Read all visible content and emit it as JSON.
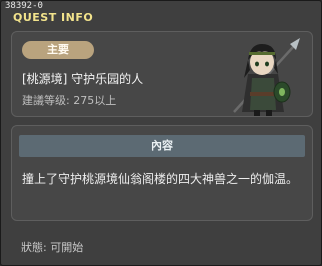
{
  "window": {
    "id": "38392-0",
    "title": "QUEST INFO"
  },
  "quest": {
    "badge": "主要",
    "name": "[桃源境] 守护乐园的人",
    "level": "建議等级: 275以上",
    "character_icon": "warrior-character-icon"
  },
  "content": {
    "header": "內容",
    "text": "撞上了守护桃源境仙翁阁楼的四大神兽之一的伽温。"
  },
  "status": {
    "text": "狀態: 可開始"
  },
  "colors": {
    "title": "#f2e38c",
    "badge": "#b9a37e",
    "header": "#5c6a73"
  }
}
